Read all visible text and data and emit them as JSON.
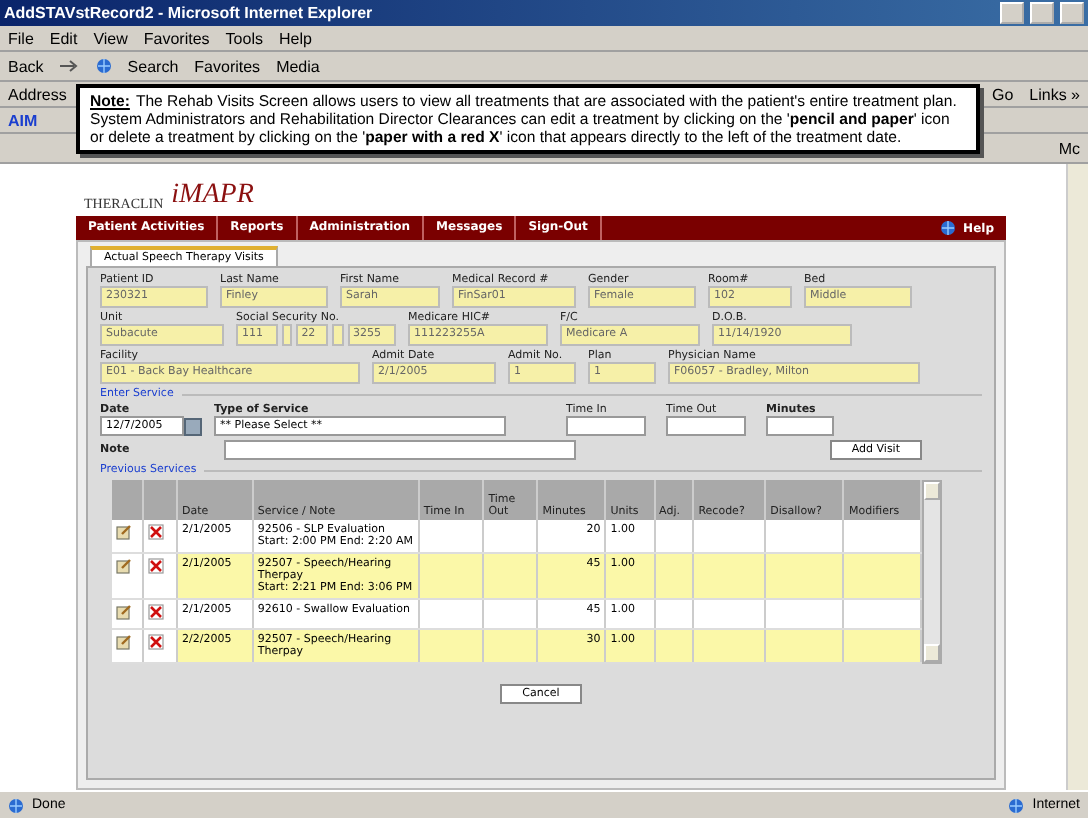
{
  "window": {
    "title": "AddSTAVstRecord2 - Microsoft Internet Explorer"
  },
  "menu": [
    "File",
    "Edit",
    "View",
    "Favorites",
    "Tools",
    "Help"
  ],
  "toolbar": {
    "back": "Back",
    "search": "Search",
    "favorites": "Favorites",
    "media": "Media"
  },
  "address_bar": {
    "label": "Address",
    "go": "Go",
    "links": "Links »"
  },
  "aim_bar": {
    "label": "AIM"
  },
  "links_bar": {
    "label": "Mc"
  },
  "note": {
    "label": "Note:",
    "text": "The Rehab Visits Screen allows users to view all treatments that are associated with the patient's entire treatment plan. System Administrators and Rehabilitation Director Clearances can edit a treatment by clicking on the '**pencil and paper**' icon or delete a treatment by clicking on the '**paper with a red X**' icon that appears directly to the left of the treatment date."
  },
  "logo": {
    "brand": "THERACLIN",
    "product": "iMAPR"
  },
  "nav": [
    {
      "label": "Patient Activities"
    },
    {
      "label": "Reports"
    },
    {
      "label": "Administration"
    },
    {
      "label": "Messages"
    },
    {
      "label": "Sign-Out"
    }
  ],
  "help": "Help",
  "tab": {
    "label": "Actual Speech Therapy Visits",
    "selected": true
  },
  "patient_rows": [
    [
      {
        "label": "Patient ID",
        "value": "230321",
        "kind": "text"
      },
      {
        "label": "Last Name",
        "value": "Finley",
        "kind": "text"
      },
      {
        "label": "First Name",
        "value": "Sarah",
        "kind": "text"
      },
      {
        "label": "Medical Record #",
        "value": "FinSar01",
        "kind": "text"
      },
      {
        "label": "Gender",
        "value": "Female",
        "kind": "text"
      },
      {
        "label": "Room#",
        "value": "102",
        "kind": "text"
      },
      {
        "label": "Bed",
        "value": "Middle",
        "kind": "text"
      }
    ],
    [
      {
        "label": "Unit",
        "value": "Subacute",
        "kind": "text"
      },
      {
        "label": "Social Security No.",
        "parts": [
          "111",
          "22",
          "3255"
        ],
        "kind": "ssn"
      },
      {
        "label": "Medicare HIC#",
        "value": "111223255A",
        "kind": "text"
      },
      {
        "label": "F/C",
        "value": "Medicare A",
        "kind": "text"
      },
      {
        "label": "D.O.B.",
        "value": "11/14/1920",
        "kind": "text"
      }
    ],
    [
      {
        "label": "Facility",
        "value": "E01 - Back Bay Healthcare",
        "kind": "text"
      },
      {
        "label": "Admit Date",
        "value": "2/1/2005",
        "kind": "text"
      },
      {
        "label": "Admit No.",
        "value": "1",
        "kind": "text"
      },
      {
        "label": "Plan",
        "value": "1",
        "kind": "text"
      },
      {
        "label": "Physician Name",
        "value": "F06057 - Bradley, Milton",
        "kind": "text"
      }
    ]
  ],
  "enter_service": {
    "title": "Enter Service",
    "date_label": "Date",
    "date_value": "12/7/2005",
    "type_label": "Type of Service",
    "type_value": "** Please Select **",
    "time_in_label": "Time In",
    "time_out_label": "Time Out",
    "minutes_label": "Minutes",
    "note_label": "Note",
    "add_button": "Add Visit"
  },
  "previous_services": {
    "title": "Previous Services",
    "columns": [
      "Date",
      "Service / Note",
      "Time In",
      "Time Out",
      "Minutes",
      "Units",
      "Adj.",
      "Recode?",
      "Disallow?",
      "Modifiers"
    ],
    "rows": [
      {
        "date": "2/1/2005",
        "service": "92506 - SLP Evaluation",
        "note": "Start: 2:00 PM End: 2:20 AM",
        "minutes": "20",
        "units": "1.00"
      },
      {
        "date": "2/1/2005",
        "service": "92507 - Speech/Hearing Therpay",
        "note": "Start: 2:21 PM End: 3:06 PM",
        "minutes": "45",
        "units": "1.00"
      },
      {
        "date": "2/1/2005",
        "service": "92610 - Swallow Evaluation",
        "minutes": "45",
        "units": "1.00"
      },
      {
        "date": "2/2/2005",
        "service": "92507 - Speech/Hearing Therpay",
        "minutes": "30",
        "units": "1.00"
      }
    ]
  },
  "cancel_button": "Cancel",
  "status_bar": {
    "text": "Done",
    "zone": "Internet"
  }
}
